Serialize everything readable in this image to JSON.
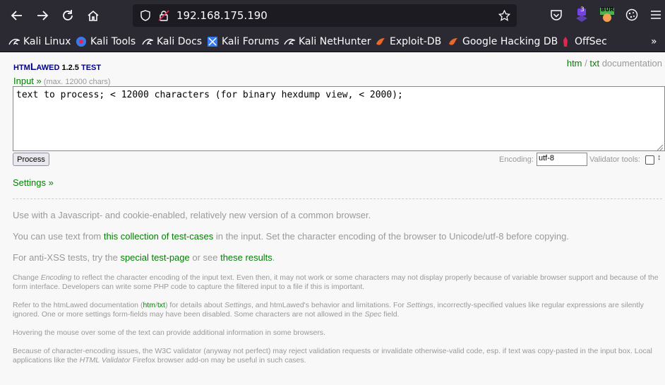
{
  "browser": {
    "url": "192.168.175.190",
    "ext_badge": "3",
    "burp_label": "BUR",
    "bookmarks": [
      {
        "label": "Kali Linux",
        "icon": "kali-dragon-icon"
      },
      {
        "label": "Kali Tools",
        "icon": "kali-tools-icon"
      },
      {
        "label": "Kali Docs",
        "icon": "kali-dragon-icon"
      },
      {
        "label": "Kali Forums",
        "icon": "kali-forums-icon"
      },
      {
        "label": "Kali NetHunter",
        "icon": "kali-dragon-icon"
      },
      {
        "label": "Exploit-DB",
        "icon": "exploit-db-icon"
      },
      {
        "label": "Google Hacking DB",
        "icon": "exploit-db-icon"
      },
      {
        "label": "OffSec",
        "icon": "offsec-icon"
      }
    ]
  },
  "page": {
    "brand_htm": "htm",
    "brand_l": "L",
    "brand_awed": "awed",
    "brand_version": "1.2.5",
    "brand_test": "test",
    "doc_htm": "htm",
    "doc_sep": " / ",
    "doc_txt": "txt",
    "doc_label": " documentation",
    "input_label": "Input »",
    "input_max": " (max. 12000 chars)",
    "input_value": "text to process; < 12000 characters (for binary hexdump view, < 2000);",
    "process_label": "Process",
    "encoding_label": "Encoding:",
    "encoding_value": "utf-8",
    "validator_label": "Validator tools:",
    "validator_arrow": "↕",
    "settings_label": "Settings »",
    "p1": "Use with a Javascript- and cookie-enabled, relatively new version of a common browser.",
    "p2_pre": "You can use text from ",
    "p2_link": "this collection of test-cases",
    "p2_post": " in the input. Set the character encoding of the browser to Unicode/utf-8 before copying.",
    "p3_pre": "For anti-XSS tests, try the ",
    "p3_link1": "special test-page",
    "p3_mid": " or see ",
    "p3_link2": "these results",
    "p3_post": ".",
    "s1_a": "Change ",
    "s1_i": "Encoding",
    "s1_b": " to reflect the character encoding of the input text. Even then, it may not work or some characters may not display properly because of variable browser support and because of the form interface. Developers can write some PHP code to capture the filtered input to a file if this is important.",
    "s2_a": "Refer to the htmLawed documentation (",
    "s2_htm": "htm",
    "s2_slash": "/",
    "s2_txt": "txt",
    "s2_b": ") for details about ",
    "s2_i1": "Settings",
    "s2_c": ", and htmLawed's behavior and limitations. For ",
    "s2_i2": "Settings",
    "s2_d": ", incorrectly-specified values like regular expressions are silently ignored. One or more settings form-fields may have been disabled. Some characters are not allowed in the ",
    "s2_i3": "Spec",
    "s2_e": " field.",
    "s3": "Hovering the mouse over some of the text can provide additional information in some browsers.",
    "s4_a": "Because of character-encoding issues, the W3C validator (anyway not perfect) may reject validation requests or invalidate otherwise-valid code, esp. if text was copy-pasted in the input box. Local applications like the ",
    "s4_i": "HTML Validator",
    "s4_b": " Firefox browser add-on may be useful in such cases."
  }
}
